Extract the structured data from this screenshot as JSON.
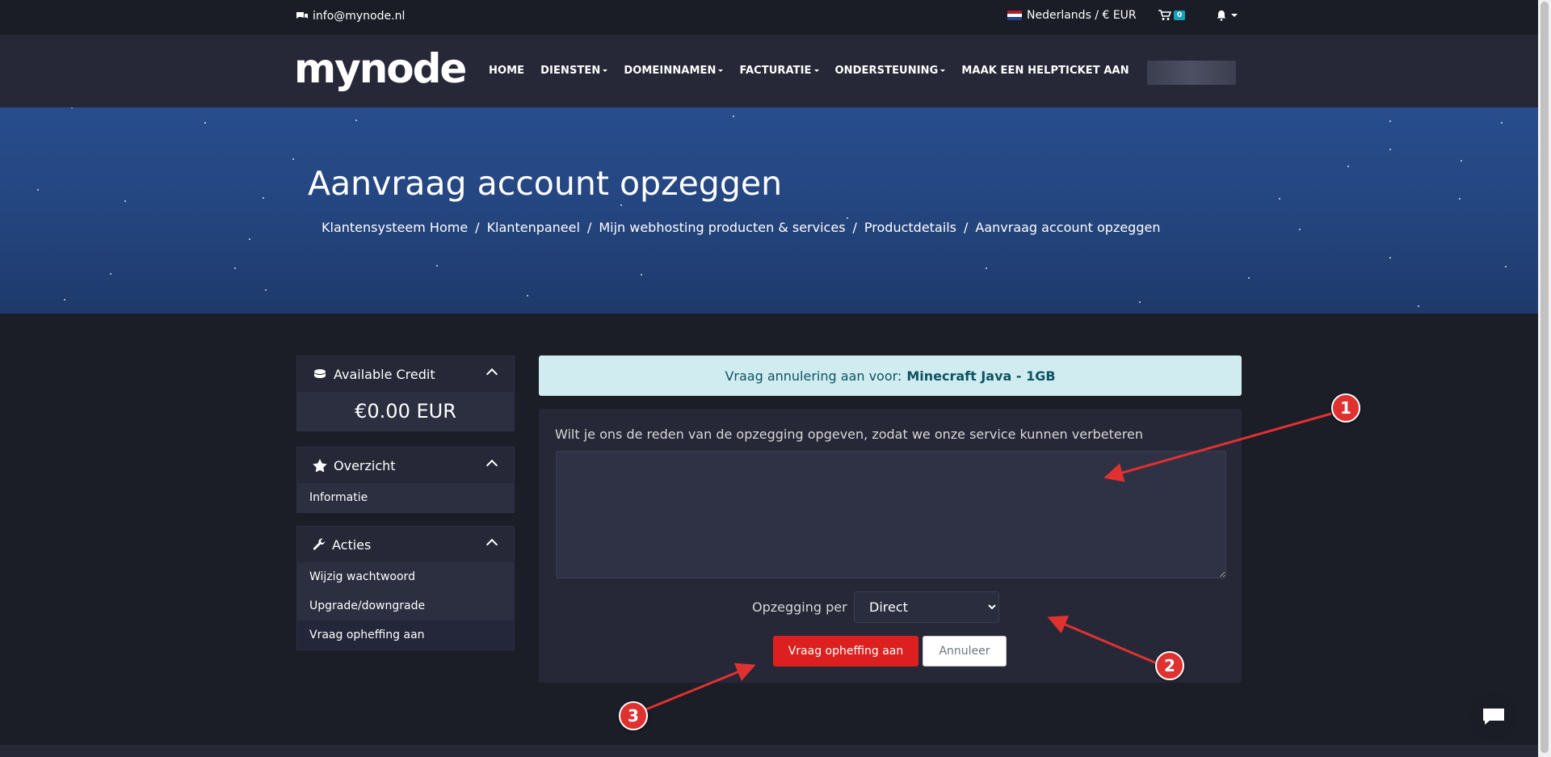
{
  "topbar": {
    "email": "info@mynode.nl",
    "language": "Nederlands / € EUR",
    "cart_count": "0"
  },
  "navbar": {
    "logo": "mynode",
    "items": [
      {
        "label": "HOME",
        "dropdown": false
      },
      {
        "label": "DIENSTEN",
        "dropdown": true
      },
      {
        "label": "DOMEINNAMEN",
        "dropdown": true
      },
      {
        "label": "FACTURATIE",
        "dropdown": true
      },
      {
        "label": "ONDERSTEUNING",
        "dropdown": true
      },
      {
        "label": "MAAK EEN HELPTICKET AAN",
        "dropdown": false
      }
    ]
  },
  "hero": {
    "title": "Aanvraag account opzeggen",
    "breadcrumb": [
      "Klantensysteem Home",
      "Klantenpaneel",
      "Mijn webhosting producten & services",
      "Productdetails",
      "Aanvraag account opzeggen"
    ]
  },
  "sidebar": {
    "credit": {
      "title": "Available Credit",
      "value": "€0.00 EUR"
    },
    "overview": {
      "title": "Overzicht",
      "items": [
        "Informatie"
      ]
    },
    "actions": {
      "title": "Acties",
      "items": [
        "Wijzig wachtwoord",
        "Upgrade/downgrade",
        "Vraag opheffing aan"
      ]
    }
  },
  "main": {
    "alert_prefix": "Vraag annulering aan voor:",
    "alert_product": "Minecraft Java - 1GB",
    "reason_label": "Wilt je ons de reden van de opzegging opgeven, zodat we onze service kunnen verbeteren",
    "reason_value": "",
    "period_label": "Opzegging per",
    "period_selected": "Direct",
    "submit_label": "Vraag opheffing aan",
    "cancel_label": "Annuleer"
  },
  "annotations": [
    "1",
    "2",
    "3"
  ],
  "colors": {
    "accent_red": "#dc1f1f",
    "alert_bg": "#d1ecf1",
    "hero_blue": "#24457f",
    "badge": "#17a2b8"
  }
}
